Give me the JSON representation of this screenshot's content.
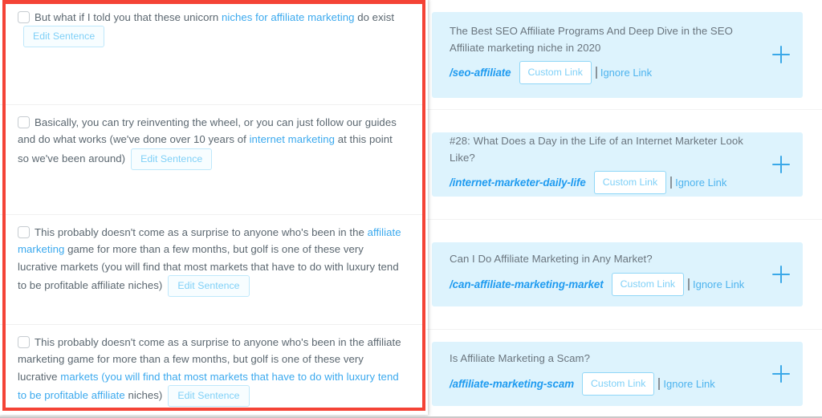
{
  "theme": {
    "highlight_frame_color": "#f44336",
    "card_background": "#ddf3fd",
    "link_color": "#3ba9ee",
    "slug_color": "#1f9bf0",
    "button_border": "#90d7f7",
    "text_color": "#5b6770"
  },
  "left_panel": {
    "sentences": [
      {
        "checkbox_checked": false,
        "segments": [
          {
            "text": "But what if I told you that these unicorn ",
            "link": false
          },
          {
            "text": "niches for affiliate marketing",
            "link": true
          },
          {
            "text": " do exist",
            "link": false
          }
        ],
        "edit_label": "Edit Sentence"
      },
      {
        "checkbox_checked": false,
        "segments": [
          {
            "text": "Basically, you can try reinventing the wheel, or you can just follow our guides and do what works (we've done over 10 years of ",
            "link": false
          },
          {
            "text": "internet marketing",
            "link": true
          },
          {
            "text": " at this point so we've been around)",
            "link": false
          }
        ],
        "edit_label": "Edit Sentence"
      },
      {
        "checkbox_checked": false,
        "segments": [
          {
            "text": "This probably doesn't come as a surprise to anyone who's been in the ",
            "link": false
          },
          {
            "text": "affiliate marketing",
            "link": true
          },
          {
            "text": " game for more than a few months, but golf is one of these very lucrative markets (you will find that most markets that have to do with luxury tend to be profitable affiliate niches)",
            "link": false
          }
        ],
        "edit_label": "Edit Sentence"
      },
      {
        "checkbox_checked": false,
        "segments": [
          {
            "text": "This probably doesn't come as a surprise to anyone who's been in the affiliate marketing game for more than a few months, but golf is one of these very lucrative ",
            "link": false
          },
          {
            "text": "markets (you will find that most markets that have to do with luxury tend to be profitable affiliate",
            "link": true
          },
          {
            "text": " niches)",
            "link": false
          }
        ],
        "edit_label": "Edit Sentence"
      }
    ]
  },
  "right_panel": {
    "suggestions": [
      {
        "title": "The Best SEO Affiliate Programs And Deep Dive in the SEO Affiliate marketing niche in 2020",
        "slug": "/seo-affiliate",
        "custom_link_label": "Custom Link",
        "ignore_link_label": "Ignore Link",
        "expand_icon": "plus-icon"
      },
      {
        "title": "#28: What Does a Day in the Life of an Internet Marketer Look Like?",
        "slug": "/internet-marketer-daily-life",
        "custom_link_label": "Custom Link",
        "ignore_link_label": "Ignore Link",
        "expand_icon": "plus-icon"
      },
      {
        "title": "Can I Do Affiliate Marketing in Any Market?",
        "slug": "/can-affiliate-marketing-market",
        "custom_link_label": "Custom Link",
        "ignore_link_label": "Ignore Link",
        "expand_icon": "plus-icon"
      },
      {
        "title": "Is Affiliate Marketing a Scam?",
        "slug": "/affiliate-marketing-scam",
        "custom_link_label": "Custom Link",
        "ignore_link_label": "Ignore Link",
        "expand_icon": "plus-icon"
      }
    ]
  }
}
